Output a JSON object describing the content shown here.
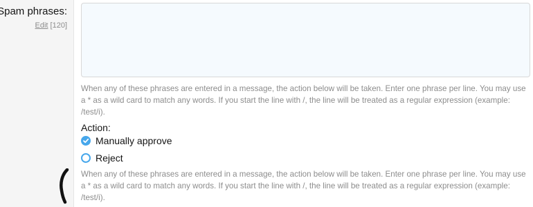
{
  "field": {
    "label": "Spam phrases:",
    "edit_link": "Edit",
    "count": "[120]",
    "textarea_value": ""
  },
  "hint_text": "When any of these phrases are entered in a message, the action below will be taken. Enter one phrase per line. You may use a * as a wild card to match any words. If you start the line with /, the line will be treated as a regular expression (example: /test/i).",
  "action": {
    "label": "Action:",
    "options": [
      {
        "label": "Manually approve",
        "checked": true
      },
      {
        "label": "Reject",
        "checked": false
      }
    ]
  },
  "hint_text_2": "When any of these phrases are entered in a message, the action below will be taken. Enter one phrase per line. You may use a * as a wild card to match any words. If you start the line with /, the line will be treated as a regular expression (example: /test/i).",
  "colors": {
    "accent": "#47a7eb",
    "label_bg": "#f5f5f5",
    "textarea_bg": "#f5fafe",
    "hint": "#8c8c8c"
  }
}
